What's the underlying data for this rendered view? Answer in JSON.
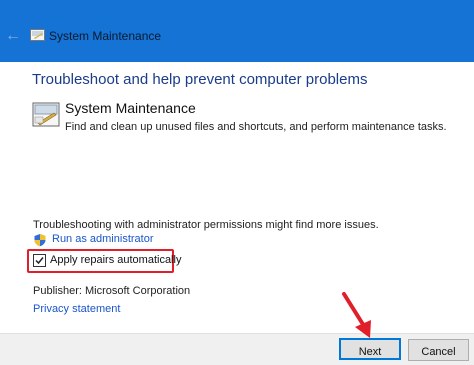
{
  "window": {
    "back_icon": "left-arrow-icon",
    "title": "System Maintenance"
  },
  "main": {
    "heading": "Troubleshoot and help prevent computer problems",
    "item": {
      "title": "System Maintenance",
      "description": "Find and clean up unused files and shortcuts, and perform maintenance tasks."
    },
    "admin_note": "Troubleshooting with administrator permissions might find more issues.",
    "run_as_admin": "Run as administrator",
    "apply_repairs": {
      "label": "Apply repairs automatically",
      "checked": true
    },
    "publisher": "Publisher:  Microsoft Corporation",
    "privacy": "Privacy statement"
  },
  "footer": {
    "next": "Next",
    "cancel": "Cancel"
  },
  "colors": {
    "titlebar": "#1473d4",
    "heading": "#1a3c8a",
    "link": "#1a56c9",
    "highlight": "#e01f2a"
  }
}
